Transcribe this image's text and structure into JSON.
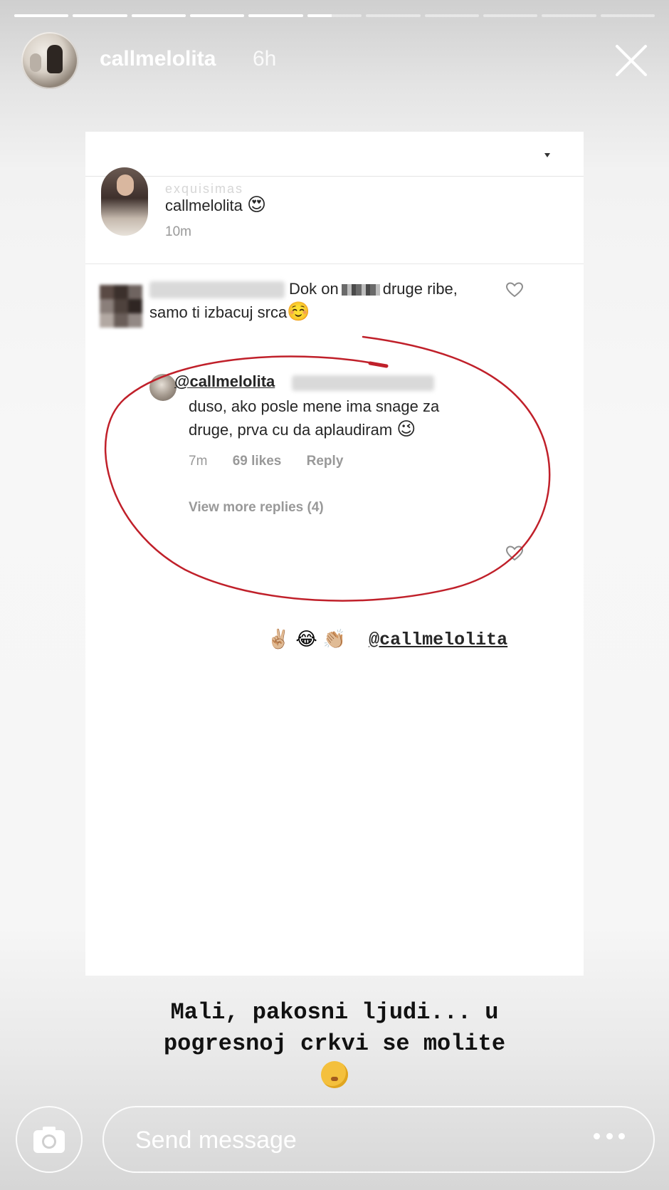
{
  "story": {
    "progress": [
      1,
      1,
      1,
      1,
      1,
      0.45,
      0,
      0,
      0,
      0,
      0
    ],
    "username": "callmelolita",
    "time_ago": "6h"
  },
  "screenshot": {
    "caption": {
      "ghost_text": "exquisimas",
      "username": "callmelolita",
      "emoji": "😍",
      "time": "10m"
    },
    "comment": {
      "text_part1": "Dok on",
      "text_part2": "druge ribe,",
      "text_line2": "samo ti izbacuj srca",
      "emoji": "☺️"
    },
    "reply": {
      "handle": "@callmelolita",
      "text_line1": "duso, ako posle mene ima snage za",
      "text_line2": "druge, prva cu da aplaudiram",
      "emoji": "😉",
      "time": "7m",
      "likes": "69 likes",
      "reply_label": "Reply",
      "view_more": "View more replies (4)"
    },
    "annotation_color": "#c0202a"
  },
  "mention": {
    "emojis": [
      "✌🏼",
      "😂",
      "👏🏼"
    ],
    "tag": "@callmelolita"
  },
  "story_caption": {
    "line1": "Mali, pakosni ljudi... u",
    "line2": "pogresnoj crkvi se molite"
  },
  "footer": {
    "message_placeholder": "Send message"
  }
}
